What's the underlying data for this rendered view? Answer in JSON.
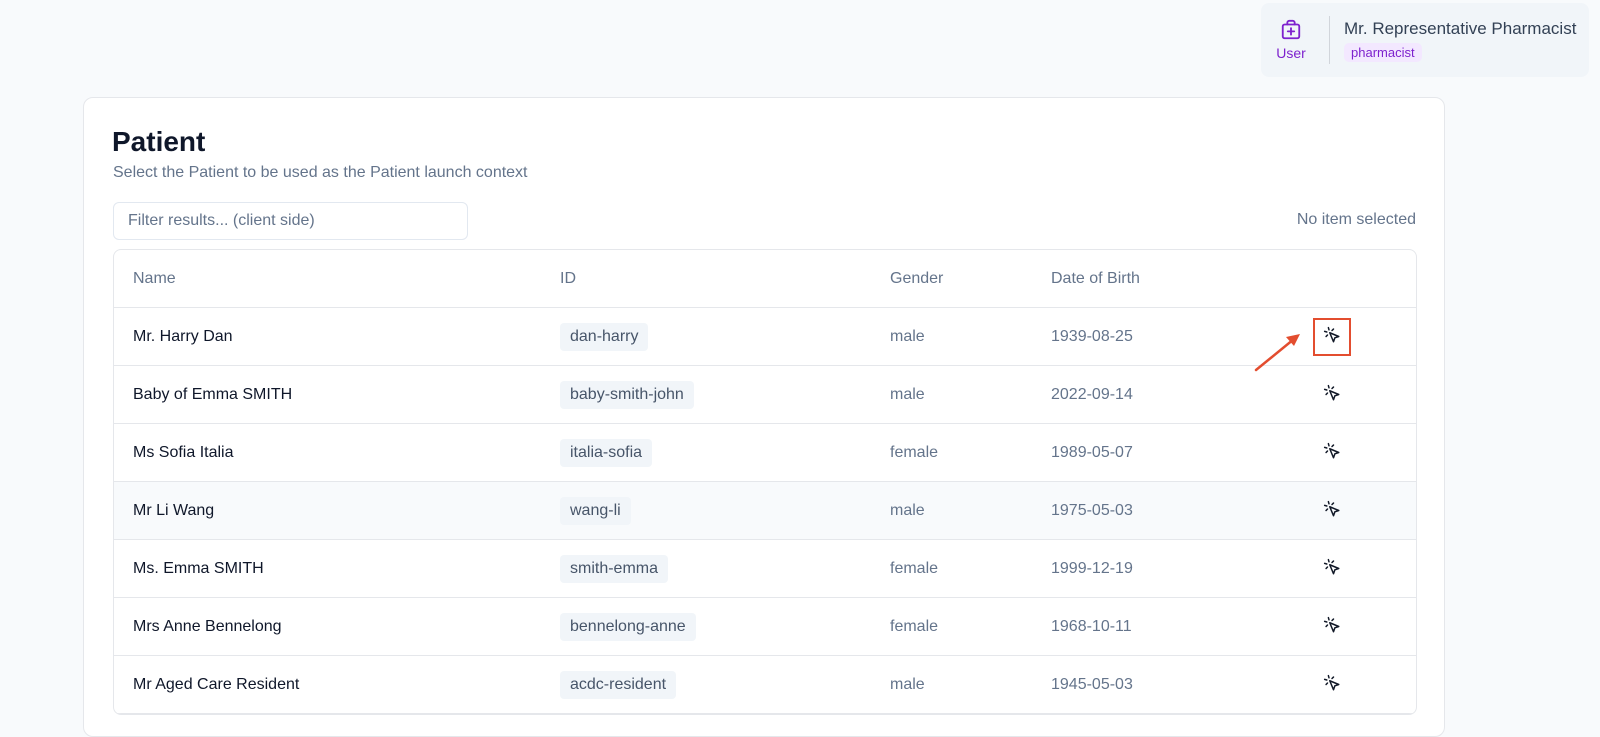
{
  "user": {
    "icon": "medical-bag-icon",
    "label": "User",
    "name": "Mr. Representative Pharmacist",
    "role": "pharmacist"
  },
  "page": {
    "title": "Patient",
    "subtitle": "Select the Patient to be used as the Patient launch context"
  },
  "filter": {
    "placeholder": "Filter results... (client side)",
    "value": ""
  },
  "selection_status": "No item selected",
  "table": {
    "columns": [
      "Name",
      "ID",
      "Gender",
      "Date of Birth",
      ""
    ],
    "rows": [
      {
        "name": "Mr. Harry Dan",
        "id": "dan-harry",
        "gender": "male",
        "dob": "1939-08-25",
        "action_icon": "click-select-icon"
      },
      {
        "name": "Baby of Emma SMITH",
        "id": "baby-smith-john",
        "gender": "male",
        "dob": "2022-09-14",
        "action_icon": "click-select-icon"
      },
      {
        "name": "Ms Sofia Italia",
        "id": "italia-sofia",
        "gender": "female",
        "dob": "1989-05-07",
        "action_icon": "click-select-icon"
      },
      {
        "name": "Mr Li Wang",
        "id": "wang-li",
        "gender": "male",
        "dob": "1975-05-03",
        "action_icon": "click-select-icon"
      },
      {
        "name": "Ms. Emma SMITH",
        "id": "smith-emma",
        "gender": "female",
        "dob": "1999-12-19",
        "action_icon": "click-select-icon"
      },
      {
        "name": "Mrs Anne Bennelong",
        "id": "bennelong-anne",
        "gender": "female",
        "dob": "1968-10-11",
        "action_icon": "click-select-icon"
      },
      {
        "name": "Mr Aged Care Resident",
        "id": "acdc-resident",
        "gender": "male",
        "dob": "1945-05-03",
        "action_icon": "click-select-icon"
      }
    ]
  },
  "colors": {
    "accent_purple": "#7e22ce",
    "annotation_red": "#e34d2f",
    "muted_text": "#64748b"
  }
}
